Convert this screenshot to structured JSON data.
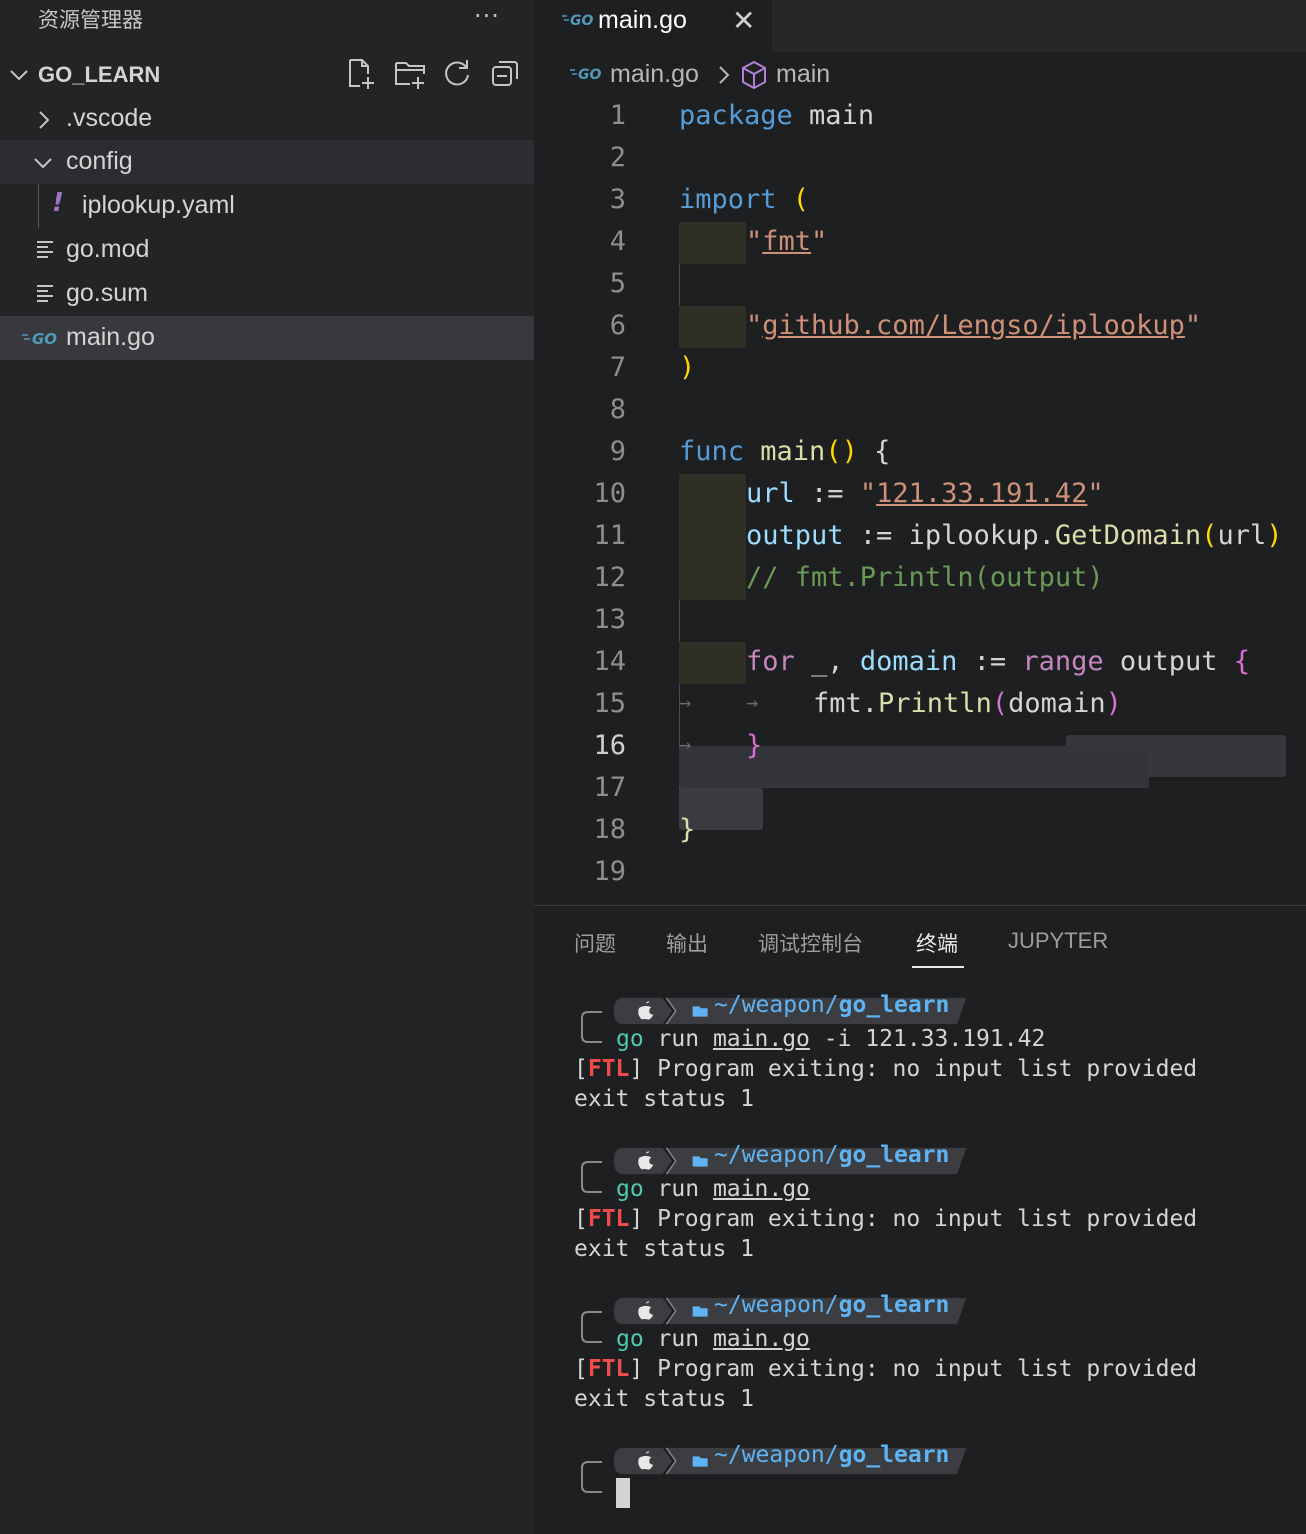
{
  "sidebar": {
    "title": "资源管理器",
    "more": "···",
    "folder": "GO_LEARN",
    "items": [
      {
        "label": ".vscode"
      },
      {
        "label": "config"
      },
      {
        "label": "iplookup.yaml"
      },
      {
        "label": "go.mod"
      },
      {
        "label": "go.sum"
      },
      {
        "label": "main.go"
      }
    ]
  },
  "editor": {
    "tab_label": "main.go",
    "tab_close": "✕",
    "breadcrumb_file": "main.go",
    "breadcrumb_symbol": "main",
    "current_line": 16,
    "line_numbers": [
      "1",
      "2",
      "3",
      "4",
      "5",
      "6",
      "7",
      "8",
      "9",
      "10",
      "11",
      "12",
      "13",
      "14",
      "15",
      "16",
      "17",
      "18",
      "19"
    ]
  },
  "code": {
    "l1_kw": "package",
    "l1_rest": " main",
    "l3_kw": "import",
    "l3_paren": " (",
    "l4_q1": "\"",
    "l4_str": "fmt",
    "l4_q2": "\"",
    "l6_q1": "\"",
    "l6_str": "github.com/Lengso/iplookup",
    "l6_q2": "\"",
    "l7_paren": ")",
    "l9_kw": "func",
    "l9_fn": " main",
    "l9_paren": "()",
    "l9_brace": " {",
    "l10_var": "url",
    "l10_op": " := ",
    "l10_q1": "\"",
    "l10_str": "121.33.191.42",
    "l10_q2": "\"",
    "l11_var": "output",
    "l11_op": " := iplookup.",
    "l11_fn": "GetDomain",
    "l11_p1": "(",
    "l11_arg": "url",
    "l11_p2": ")",
    "l12_cmt": "// fmt.Println(output)",
    "l14_kw": "for",
    "l14_a": " _, ",
    "l14_var": "domain",
    "l14_op": " := ",
    "l14_kw2": "range",
    "l14_b": " output ",
    "l14_brace": "{",
    "l15_pkg": "fmt.",
    "l15_fn": "Println",
    "l15_p1": "(",
    "l15_arg": "domain",
    "l15_p2": ")",
    "l16_brace": "}",
    "l18_brace": "}",
    "arrow": "→"
  },
  "panel": {
    "tabs": [
      "问题",
      "输出",
      "调试控制台",
      "终端",
      "JUPYTER"
    ],
    "active_tab": "终端"
  },
  "terminal": {
    "prompt_path_prefix": "~/weapon/",
    "prompt_path_dir": "go_learn",
    "runs": [
      {
        "cmd_go": "go",
        "cmd_run": " run ",
        "cmd_file": "main.go",
        "cmd_args": " -i 121.33.191.42",
        "err_open": "[",
        "err_tag": "FTL",
        "err_close": "]",
        "err_msg": " Program exiting: no input list provided",
        "status": "exit status 1"
      },
      {
        "cmd_go": "go",
        "cmd_run": " run ",
        "cmd_file": "main.go",
        "cmd_args": "",
        "err_open": "[",
        "err_tag": "FTL",
        "err_close": "]",
        "err_msg": " Program exiting: no input list provided",
        "status": "exit status 1"
      },
      {
        "cmd_go": "go",
        "cmd_run": " run ",
        "cmd_file": "main.go",
        "cmd_args": "",
        "err_open": "[",
        "err_tag": "FTL",
        "err_close": "]",
        "err_msg": " Program exiting: no input list provided",
        "status": "exit status 1"
      }
    ]
  }
}
